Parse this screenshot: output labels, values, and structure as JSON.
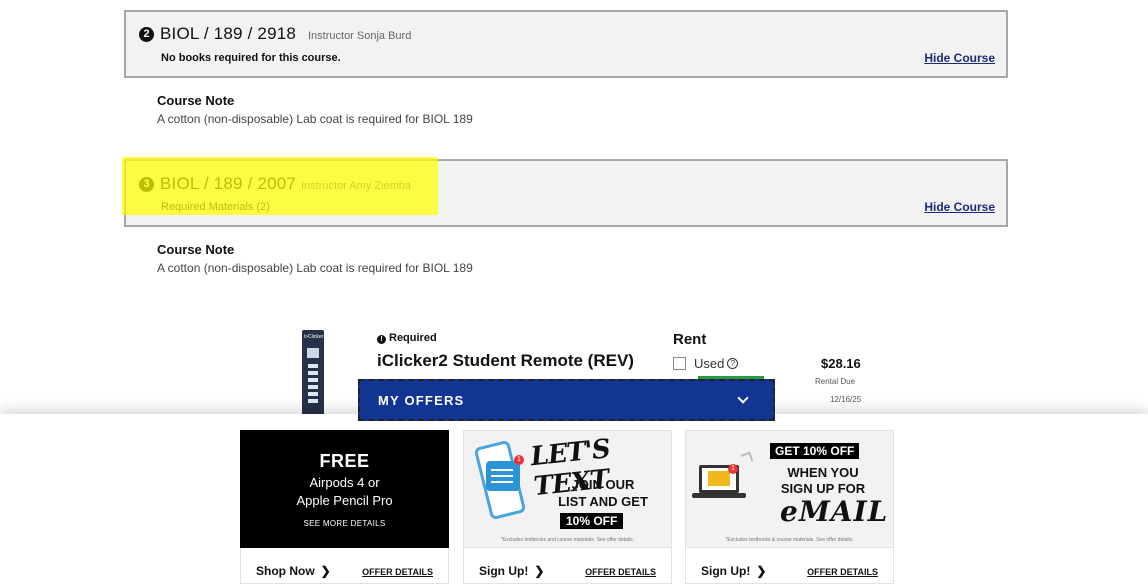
{
  "courses": [
    {
      "number": "2",
      "code": "BIOL / 189 / 2918",
      "instructor": "Instructor Sonja Burd",
      "subtext": "No books required for this course.",
      "hide_label": "Hide Course",
      "note_title": "Course Note",
      "note_text": "A cotton (non-disposable) Lab coat is required for BIOL 189"
    },
    {
      "number": "3",
      "code": "BIOL / 189 / 2007",
      "instructor": "Instructor Amy Ziemba",
      "subtext": "Required Materials (2)",
      "hide_label": "Hide Course",
      "note_title": "Course Note",
      "note_text": "A cotton (non-disposable) Lab coat is required for BIOL 189",
      "highlighted": true
    }
  ],
  "product": {
    "image_brand": "i>Clicker",
    "required_label": "Required",
    "name": "iClicker2 Student Remote (REV)",
    "rent_label": "Rent",
    "used_label": "Used",
    "price": "$28.16",
    "rental_due_label": "Rental Due",
    "rental_due_date": "12/16/25"
  },
  "offers_bar": {
    "label": "MY OFFERS"
  },
  "offers": [
    {
      "free": "FREE",
      "line1": "Airpods 4 or",
      "line2": "Apple Pencil Pro",
      "see_more": "SEE MORE DETAILS",
      "cta": "Shop Now",
      "details": "OFFER DETAILS"
    },
    {
      "headline": "LET'S TEXT",
      "line1": "JOIN OUR",
      "line2": "LIST AND GET",
      "pct": "10% OFF",
      "fine": "*Excludes textbooks and course materials. See offer details.",
      "notif": "1",
      "cta": "Sign Up!",
      "details": "OFFER DETAILS"
    },
    {
      "headline": "GET 10% OFF",
      "line1": "WHEN YOU",
      "line2": "SIGN UP FOR",
      "email": "eMAIL",
      "fine": "*Excludes textbooks & course materials. See offer details.",
      "notif": "1",
      "cta": "Sign Up!",
      "details": "OFFER DETAILS"
    }
  ],
  "colors": {
    "offers_bar": "#123593",
    "link": "#1b2a7a",
    "highlight": "#ffff00",
    "stock_green": "#2e9b3e"
  }
}
